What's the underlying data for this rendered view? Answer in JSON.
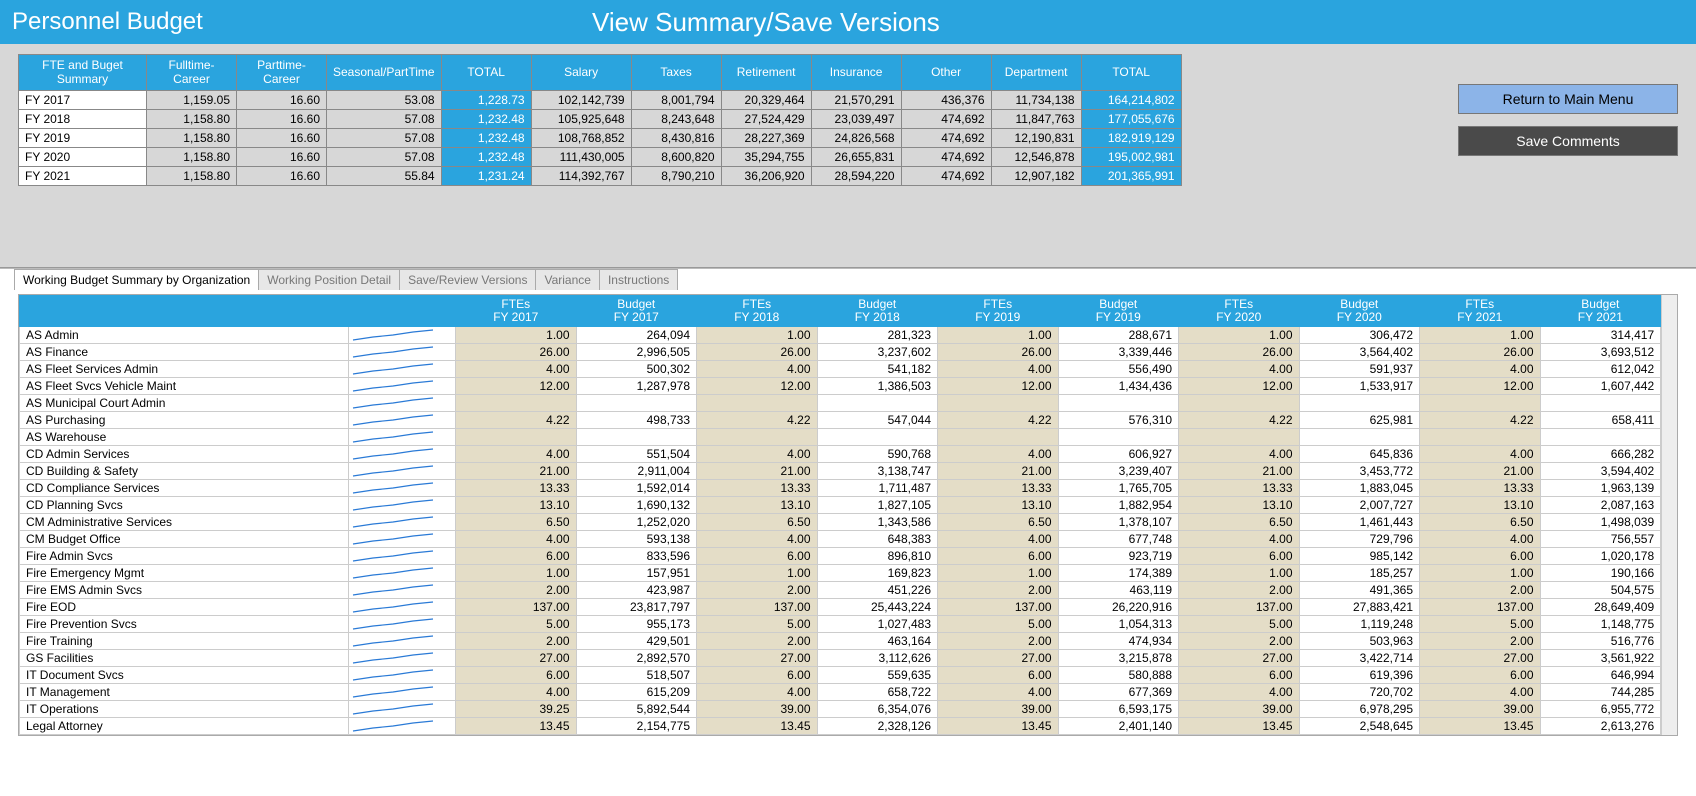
{
  "header": {
    "title_left": "Personnel Budget",
    "title_right": "View Summary/Save Versions"
  },
  "buttons": {
    "return": "Return to Main Menu",
    "save": "Save Comments"
  },
  "summary_headers": [
    "FTE and Buget\nSummary",
    "Fulltime-Career",
    "Parttime-Career",
    "Seasonal/PartTime",
    "TOTAL",
    "Salary",
    "Taxes",
    "Retirement",
    "Insurance",
    "Other",
    "Department",
    "TOTAL"
  ],
  "summary_rows": [
    {
      "label": "FY 2017",
      "fc": "1,159.05",
      "pc": "16.60",
      "sp": "53.08",
      "t1": "1,228.73",
      "sal": "102,142,739",
      "tax": "8,001,794",
      "ret": "20,329,464",
      "ins": "21,570,291",
      "oth": "436,376",
      "dep": "11,734,138",
      "t2": "164,214,802"
    },
    {
      "label": "FY 2018",
      "fc": "1,158.80",
      "pc": "16.60",
      "sp": "57.08",
      "t1": "1,232.48",
      "sal": "105,925,648",
      "tax": "8,243,648",
      "ret": "27,524,429",
      "ins": "23,039,497",
      "oth": "474,692",
      "dep": "11,847,763",
      "t2": "177,055,676"
    },
    {
      "label": "FY 2019",
      "fc": "1,158.80",
      "pc": "16.60",
      "sp": "57.08",
      "t1": "1,232.48",
      "sal": "108,768,852",
      "tax": "8,430,816",
      "ret": "28,227,369",
      "ins": "24,826,568",
      "oth": "474,692",
      "dep": "12,190,831",
      "t2": "182,919,129"
    },
    {
      "label": "FY 2020",
      "fc": "1,158.80",
      "pc": "16.60",
      "sp": "57.08",
      "t1": "1,232.48",
      "sal": "111,430,005",
      "tax": "8,600,820",
      "ret": "35,294,755",
      "ins": "26,655,831",
      "oth": "474,692",
      "dep": "12,546,878",
      "t2": "195,002,981"
    },
    {
      "label": "FY 2021",
      "fc": "1,158.80",
      "pc": "16.60",
      "sp": "55.84",
      "t1": "1,231.24",
      "sal": "114,392,767",
      "tax": "8,790,210",
      "ret": "36,206,920",
      "ins": "28,594,220",
      "oth": "474,692",
      "dep": "12,907,182",
      "t2": "201,365,991"
    }
  ],
  "tabs": [
    "Working Budget Summary by Organization",
    "Working Position Detail",
    "Save/Review Versions",
    "Variance",
    "Instructions"
  ],
  "org_headers": [
    "",
    "",
    "FTEs\nFY 2017",
    "Budget\nFY 2017",
    "FTEs\nFY 2018",
    "Budget\nFY 2018",
    "FTEs\nFY 2019",
    "Budget\nFY 2019",
    "FTEs\nFY 2020",
    "Budget\nFY 2020",
    "FTEs\nFY 2021",
    "Budget\nFY 2021"
  ],
  "org_rows": [
    {
      "label": "AS Admin",
      "f17": "1.00",
      "b17": "264,094",
      "f18": "1.00",
      "b18": "281,323",
      "f19": "1.00",
      "b19": "288,671",
      "f20": "1.00",
      "b20": "306,472",
      "f21": "1.00",
      "b21": "314,417"
    },
    {
      "label": "AS Finance",
      "f17": "26.00",
      "b17": "2,996,505",
      "f18": "26.00",
      "b18": "3,237,602",
      "f19": "26.00",
      "b19": "3,339,446",
      "f20": "26.00",
      "b20": "3,564,402",
      "f21": "26.00",
      "b21": "3,693,512"
    },
    {
      "label": "AS Fleet Services Admin",
      "f17": "4.00",
      "b17": "500,302",
      "f18": "4.00",
      "b18": "541,182",
      "f19": "4.00",
      "b19": "556,490",
      "f20": "4.00",
      "b20": "591,937",
      "f21": "4.00",
      "b21": "612,042"
    },
    {
      "label": "AS Fleet Svcs Vehicle Maint",
      "f17": "12.00",
      "b17": "1,287,978",
      "f18": "12.00",
      "b18": "1,386,503",
      "f19": "12.00",
      "b19": "1,434,436",
      "f20": "12.00",
      "b20": "1,533,917",
      "f21": "12.00",
      "b21": "1,607,442"
    },
    {
      "label": "AS Municipal Court Admin",
      "f17": "",
      "b17": "",
      "f18": "",
      "b18": "",
      "f19": "",
      "b19": "",
      "f20": "",
      "b20": "",
      "f21": "",
      "b21": ""
    },
    {
      "label": "AS Purchasing",
      "f17": "4.22",
      "b17": "498,733",
      "f18": "4.22",
      "b18": "547,044",
      "f19": "4.22",
      "b19": "576,310",
      "f20": "4.22",
      "b20": "625,981",
      "f21": "4.22",
      "b21": "658,411"
    },
    {
      "label": "AS Warehouse",
      "f17": "",
      "b17": "",
      "f18": "",
      "b18": "",
      "f19": "",
      "b19": "",
      "f20": "",
      "b20": "",
      "f21": "",
      "b21": ""
    },
    {
      "label": "CD Admin Services",
      "f17": "4.00",
      "b17": "551,504",
      "f18": "4.00",
      "b18": "590,768",
      "f19": "4.00",
      "b19": "606,927",
      "f20": "4.00",
      "b20": "645,836",
      "f21": "4.00",
      "b21": "666,282"
    },
    {
      "label": "CD Building & Safety",
      "f17": "21.00",
      "b17": "2,911,004",
      "f18": "21.00",
      "b18": "3,138,747",
      "f19": "21.00",
      "b19": "3,239,407",
      "f20": "21.00",
      "b20": "3,453,772",
      "f21": "21.00",
      "b21": "3,594,402"
    },
    {
      "label": "CD Compliance Services",
      "f17": "13.33",
      "b17": "1,592,014",
      "f18": "13.33",
      "b18": "1,711,487",
      "f19": "13.33",
      "b19": "1,765,705",
      "f20": "13.33",
      "b20": "1,883,045",
      "f21": "13.33",
      "b21": "1,963,139"
    },
    {
      "label": "CD Planning Svcs",
      "f17": "13.10",
      "b17": "1,690,132",
      "f18": "13.10",
      "b18": "1,827,105",
      "f19": "13.10",
      "b19": "1,882,954",
      "f20": "13.10",
      "b20": "2,007,727",
      "f21": "13.10",
      "b21": "2,087,163"
    },
    {
      "label": "CM Administrative Services",
      "f17": "6.50",
      "b17": "1,252,020",
      "f18": "6.50",
      "b18": "1,343,586",
      "f19": "6.50",
      "b19": "1,378,107",
      "f20": "6.50",
      "b20": "1,461,443",
      "f21": "6.50",
      "b21": "1,498,039"
    },
    {
      "label": "CM Budget Office",
      "f17": "4.00",
      "b17": "593,138",
      "f18": "4.00",
      "b18": "648,383",
      "f19": "4.00",
      "b19": "677,748",
      "f20": "4.00",
      "b20": "729,796",
      "f21": "4.00",
      "b21": "756,557"
    },
    {
      "label": "Fire Admin Svcs",
      "f17": "6.00",
      "b17": "833,596",
      "f18": "6.00",
      "b18": "896,810",
      "f19": "6.00",
      "b19": "923,719",
      "f20": "6.00",
      "b20": "985,142",
      "f21": "6.00",
      "b21": "1,020,178"
    },
    {
      "label": "Fire Emergency Mgmt",
      "f17": "1.00",
      "b17": "157,951",
      "f18": "1.00",
      "b18": "169,823",
      "f19": "1.00",
      "b19": "174,389",
      "f20": "1.00",
      "b20": "185,257",
      "f21": "1.00",
      "b21": "190,166"
    },
    {
      "label": "Fire EMS Admin Svcs",
      "f17": "2.00",
      "b17": "423,987",
      "f18": "2.00",
      "b18": "451,226",
      "f19": "2.00",
      "b19": "463,119",
      "f20": "2.00",
      "b20": "491,365",
      "f21": "2.00",
      "b21": "504,575"
    },
    {
      "label": "Fire EOD",
      "f17": "137.00",
      "b17": "23,817,797",
      "f18": "137.00",
      "b18": "25,443,224",
      "f19": "137.00",
      "b19": "26,220,916",
      "f20": "137.00",
      "b20": "27,883,421",
      "f21": "137.00",
      "b21": "28,649,409"
    },
    {
      "label": "Fire Prevention Svcs",
      "f17": "5.00",
      "b17": "955,173",
      "f18": "5.00",
      "b18": "1,027,483",
      "f19": "5.00",
      "b19": "1,054,313",
      "f20": "5.00",
      "b20": "1,119,248",
      "f21": "5.00",
      "b21": "1,148,775"
    },
    {
      "label": "Fire Training",
      "f17": "2.00",
      "b17": "429,501",
      "f18": "2.00",
      "b18": "463,164",
      "f19": "2.00",
      "b19": "474,934",
      "f20": "2.00",
      "b20": "503,963",
      "f21": "2.00",
      "b21": "516,776"
    },
    {
      "label": "GS Facilities",
      "f17": "27.00",
      "b17": "2,892,570",
      "f18": "27.00",
      "b18": "3,112,626",
      "f19": "27.00",
      "b19": "3,215,878",
      "f20": "27.00",
      "b20": "3,422,714",
      "f21": "27.00",
      "b21": "3,561,922"
    },
    {
      "label": "IT Document Svcs",
      "f17": "6.00",
      "b17": "518,507",
      "f18": "6.00",
      "b18": "559,635",
      "f19": "6.00",
      "b19": "580,888",
      "f20": "6.00",
      "b20": "619,396",
      "f21": "6.00",
      "b21": "646,994"
    },
    {
      "label": "IT Management",
      "f17": "4.00",
      "b17": "615,209",
      "f18": "4.00",
      "b18": "658,722",
      "f19": "4.00",
      "b19": "677,369",
      "f20": "4.00",
      "b20": "720,702",
      "f21": "4.00",
      "b21": "744,285"
    },
    {
      "label": "IT Operations",
      "f17": "39.25",
      "b17": "5,892,544",
      "f18": "39.00",
      "b18": "6,354,076",
      "f19": "39.00",
      "b19": "6,593,175",
      "f20": "39.00",
      "b20": "6,978,295",
      "f21": "39.00",
      "b21": "6,955,772"
    },
    {
      "label": "Legal Attorney",
      "f17": "13.45",
      "b17": "2,154,775",
      "f18": "13.45",
      "b18": "2,328,126",
      "f19": "13.45",
      "b19": "2,401,140",
      "f20": "13.45",
      "b20": "2,548,645",
      "f21": "13.45",
      "b21": "2,613,276"
    }
  ]
}
